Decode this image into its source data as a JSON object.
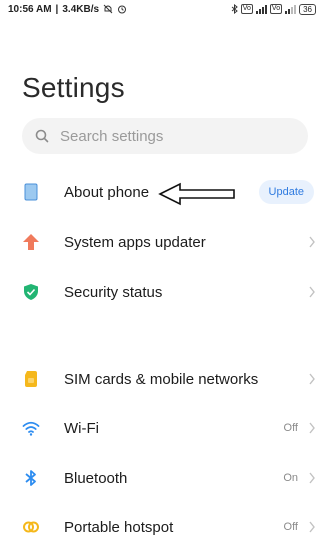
{
  "status_bar": {
    "time": "10:56 AM",
    "speed": "3.4KB/s",
    "battery": "36",
    "icons": [
      "mute-icon",
      "alarm-icon",
      "bluetooth-icon",
      "vo-lte-icon",
      "signal-icon",
      "vo-lte-icon",
      "signal-icon",
      "battery-icon"
    ]
  },
  "page": {
    "title": "Settings"
  },
  "search": {
    "placeholder": "Search settings"
  },
  "items": [
    {
      "label": "About phone",
      "badge": "Update",
      "icon": "phone-icon"
    },
    {
      "label": "System apps updater",
      "icon": "arrow-up-icon"
    },
    {
      "label": "Security status",
      "icon": "shield-check-icon"
    },
    {
      "label": "SIM cards & mobile networks",
      "icon": "sim-card-icon"
    },
    {
      "label": "Wi-Fi",
      "value": "Off",
      "icon": "wifi-icon"
    },
    {
      "label": "Bluetooth",
      "value": "On",
      "icon": "bluetooth-icon"
    },
    {
      "label": "Portable hotspot",
      "value": "Off",
      "icon": "hotspot-icon"
    }
  ],
  "colors": {
    "accent": "#2f7be0",
    "update_arrow": "#f07a5c",
    "shield": "#22b573",
    "sim": "#f5b81c",
    "wifi": "#2e8df0",
    "bluetooth": "#2e8df0",
    "hotspot": "#f5b81c"
  }
}
